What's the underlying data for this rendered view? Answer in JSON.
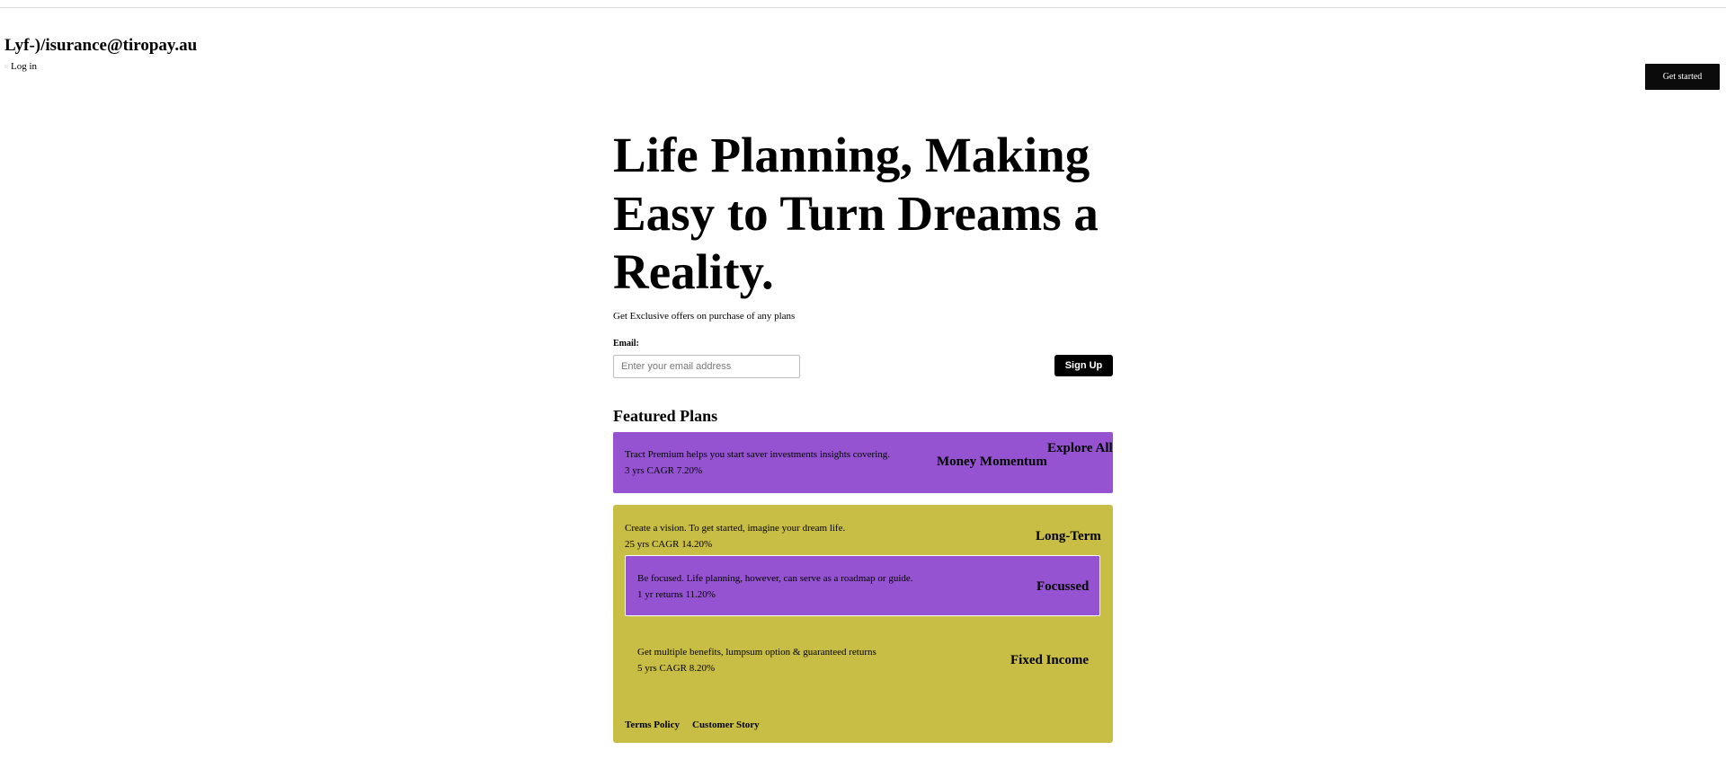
{
  "header": {
    "brand": "Lyf-)/isurance@tiropay.au",
    "login_label": "Log in",
    "get_started_label": "Get started"
  },
  "hero": {
    "title": "Life Planning, Making Easy to Turn Dreams a Reality.",
    "subtitle": "Get Exclusive offers on purchase of any plans"
  },
  "signup_form": {
    "email_label": "Email:",
    "email_placeholder": "Enter your email address",
    "email_value": "",
    "submit_label": "Sign Up"
  },
  "featured": {
    "title": "Featured Plans",
    "explore_all_label": "Explore All",
    "plans": [
      {
        "name": "Money Momentum",
        "description": "Tract Premium helps you start saver investments insights covering.",
        "stat": "3 yrs CAGR 7.20%"
      },
      {
        "name": "Long-Term",
        "description": "Create a vision. To get started, imagine your dream life.",
        "stat": "25 yrs CAGR 14.20%"
      },
      {
        "name": "Focussed",
        "description": "Be focused. Life planning, however, can serve as a roadmap or guide.",
        "stat": "1 yr returns 11.20%"
      },
      {
        "name": "Fixed Income",
        "description": "Get multiple benefits, lumpsum option & guaranteed returns",
        "stat": "5 yrs CAGR 8.20%"
      }
    ]
  },
  "footer": {
    "links": [
      "Terms Policy",
      "Customer Story"
    ]
  },
  "colors": {
    "purple_card": "#9553d1",
    "olive_card": "#c9be45",
    "button_dark": "#0b0b0b"
  }
}
